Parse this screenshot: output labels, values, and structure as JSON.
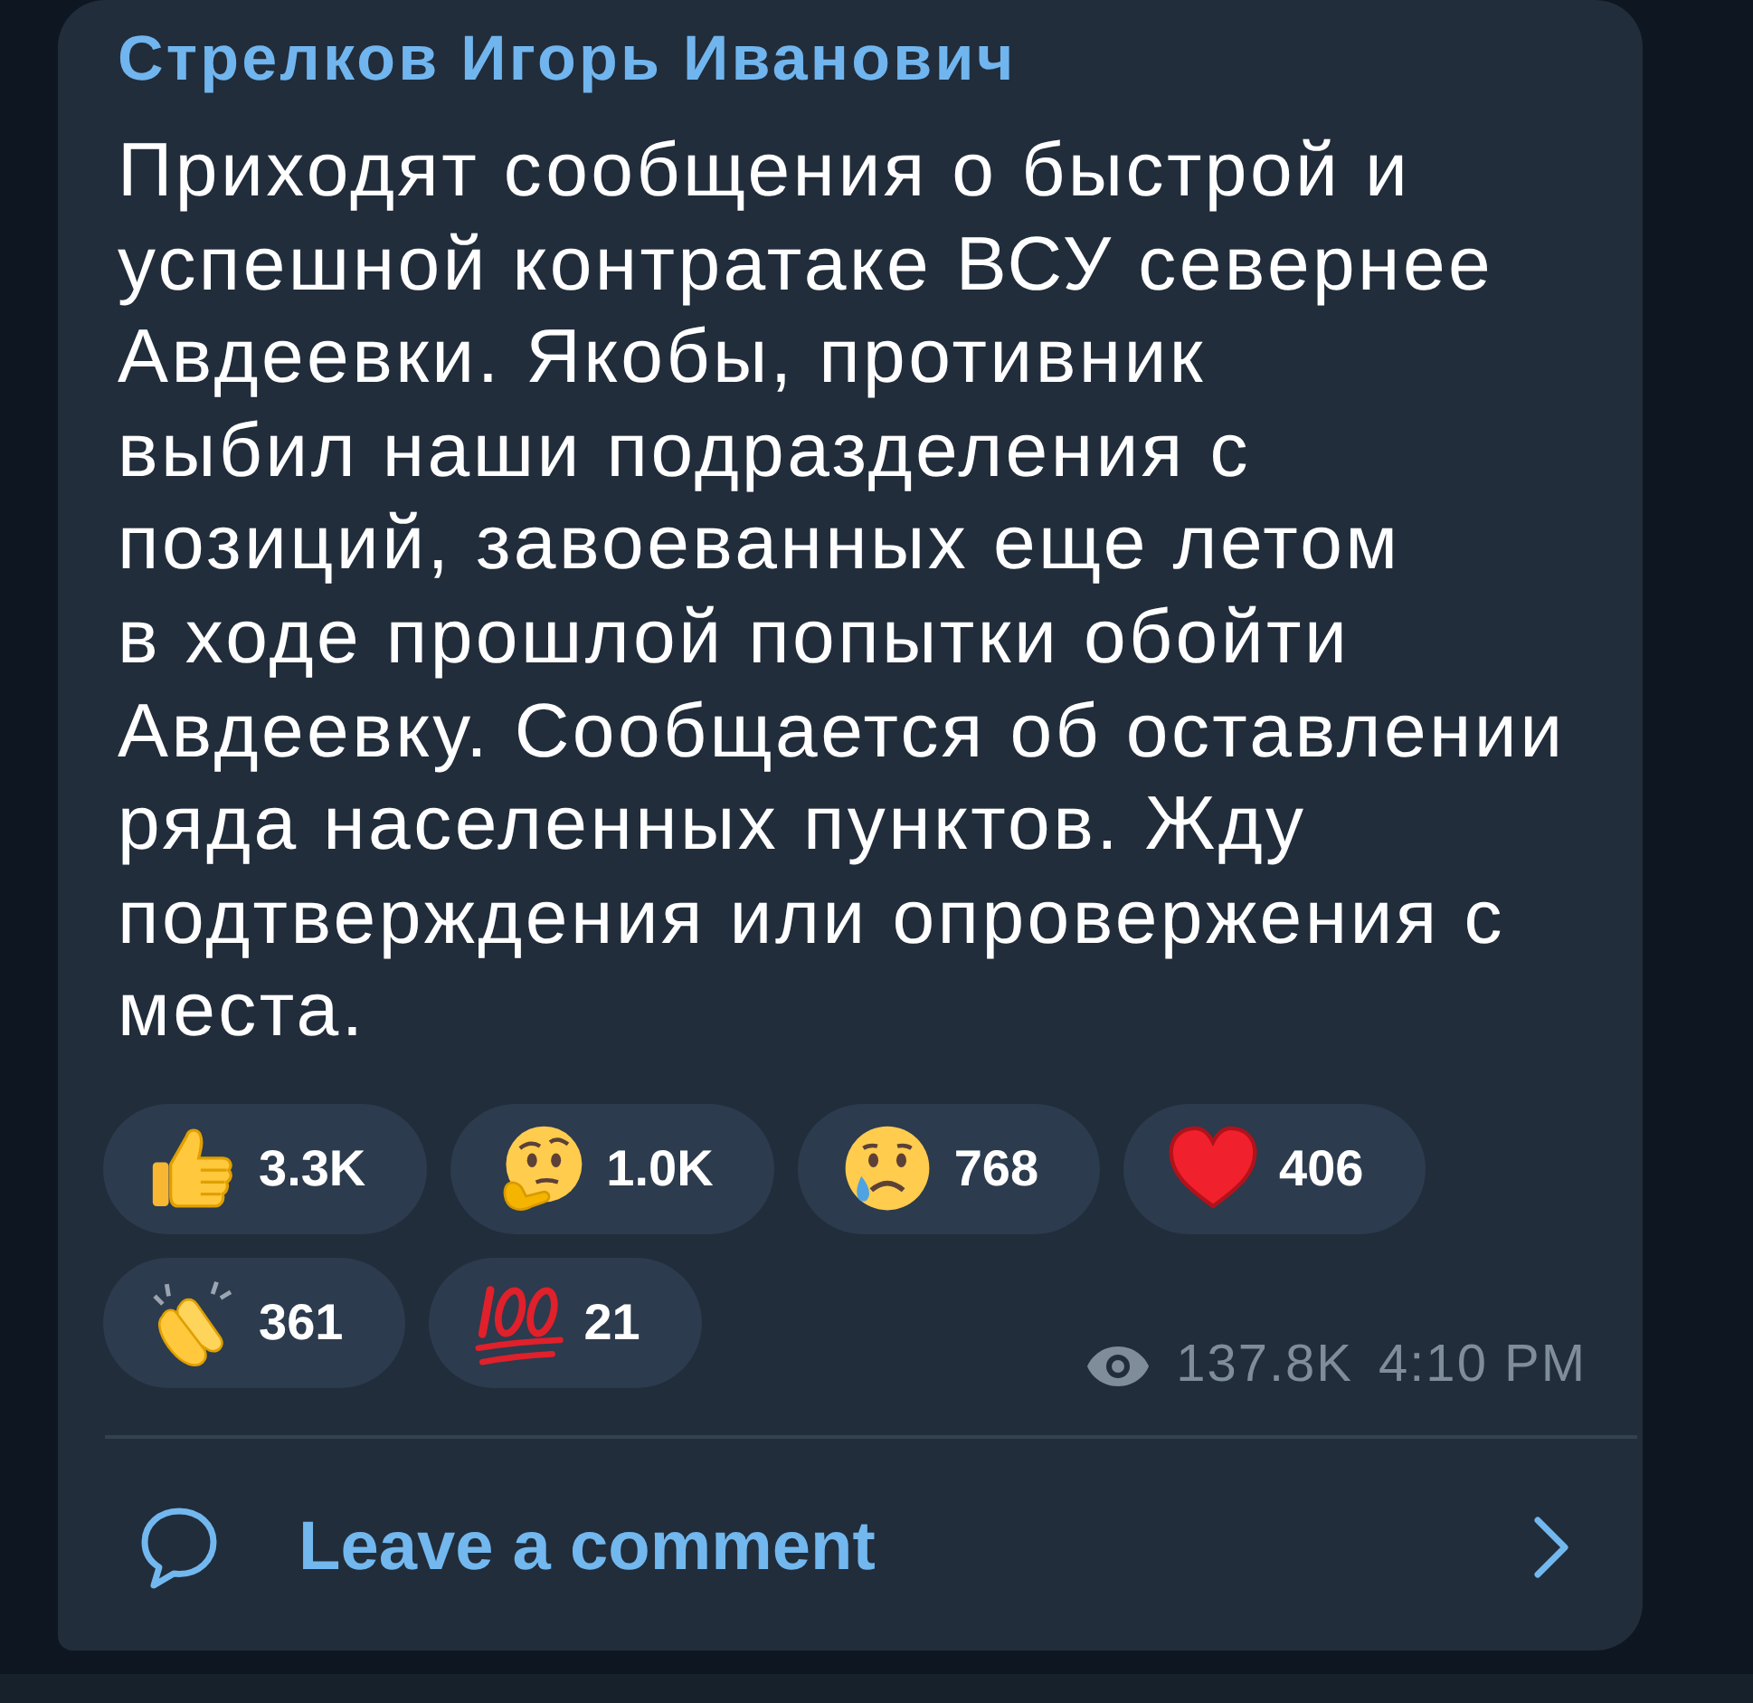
{
  "message": {
    "author": "Стрелков Игорь Иванович",
    "text": "Приходят сообщения о быстрой и\nуспешной контратаке ВСУ севернее\nАвдеевки. Якобы, противник\nвыбил наши подразделения с\nпозиций, завоеванных еще летом\nв ходе прошлой попытки обойти\nАвдеевку. Сообщается об оставлении\nряда населенных пунктов. Жду\nподтверждения или опровержения с\nместа.",
    "reactions": [
      {
        "kind": "thumbs_up",
        "count": "3.3K",
        "selected": false
      },
      {
        "kind": "thinking",
        "count": "1.0K",
        "selected": false
      },
      {
        "kind": "crying",
        "count": "768",
        "selected": false
      },
      {
        "kind": "heart",
        "count": "406",
        "selected": false
      },
      {
        "kind": "clap",
        "count": "361",
        "selected": false
      },
      {
        "kind": "hundred",
        "count": "21",
        "selected": false
      }
    ],
    "views": "137.8K",
    "time": "4:10 PM",
    "comment_link": "Leave a comment"
  }
}
